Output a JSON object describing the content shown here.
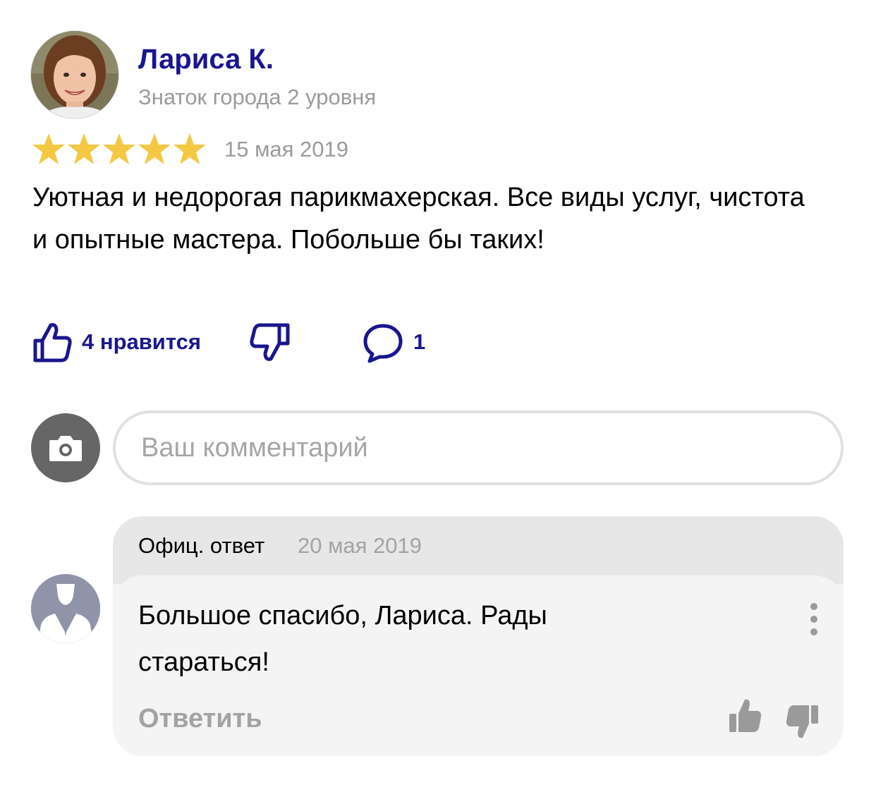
{
  "review": {
    "author_name": "Лариса К.",
    "author_level": "Знаток города 2 уровня",
    "rating": 5,
    "rating_max": 5,
    "date": "15 мая 2019",
    "text": "Уютная и недорогая парикмахерская. Все виды услуг, чистота и опытные мастера. Побольше бы таких!"
  },
  "actions": {
    "like_label": "4 нравится",
    "comment_count": "1"
  },
  "comment_box": {
    "placeholder": "Ваш комментарий"
  },
  "official_reply": {
    "label": "Офиц. ответ",
    "date": "20 мая 2019",
    "text": "Большое спасибо, Лариса. Рады стараться!",
    "reply_label": "Ответить"
  },
  "colors": {
    "accent": "#1a168f",
    "star": "#f4c842",
    "muted_text": "#9b9b9b",
    "reply_bg": "#f4f4f4",
    "reply_head_bg": "#e7e7e7"
  },
  "icons": {
    "like": "thumbs-up-icon",
    "dislike": "thumbs-down-icon",
    "comment": "speech-bubble-icon",
    "camera": "camera-icon",
    "menu": "vertical-dots-icon"
  }
}
